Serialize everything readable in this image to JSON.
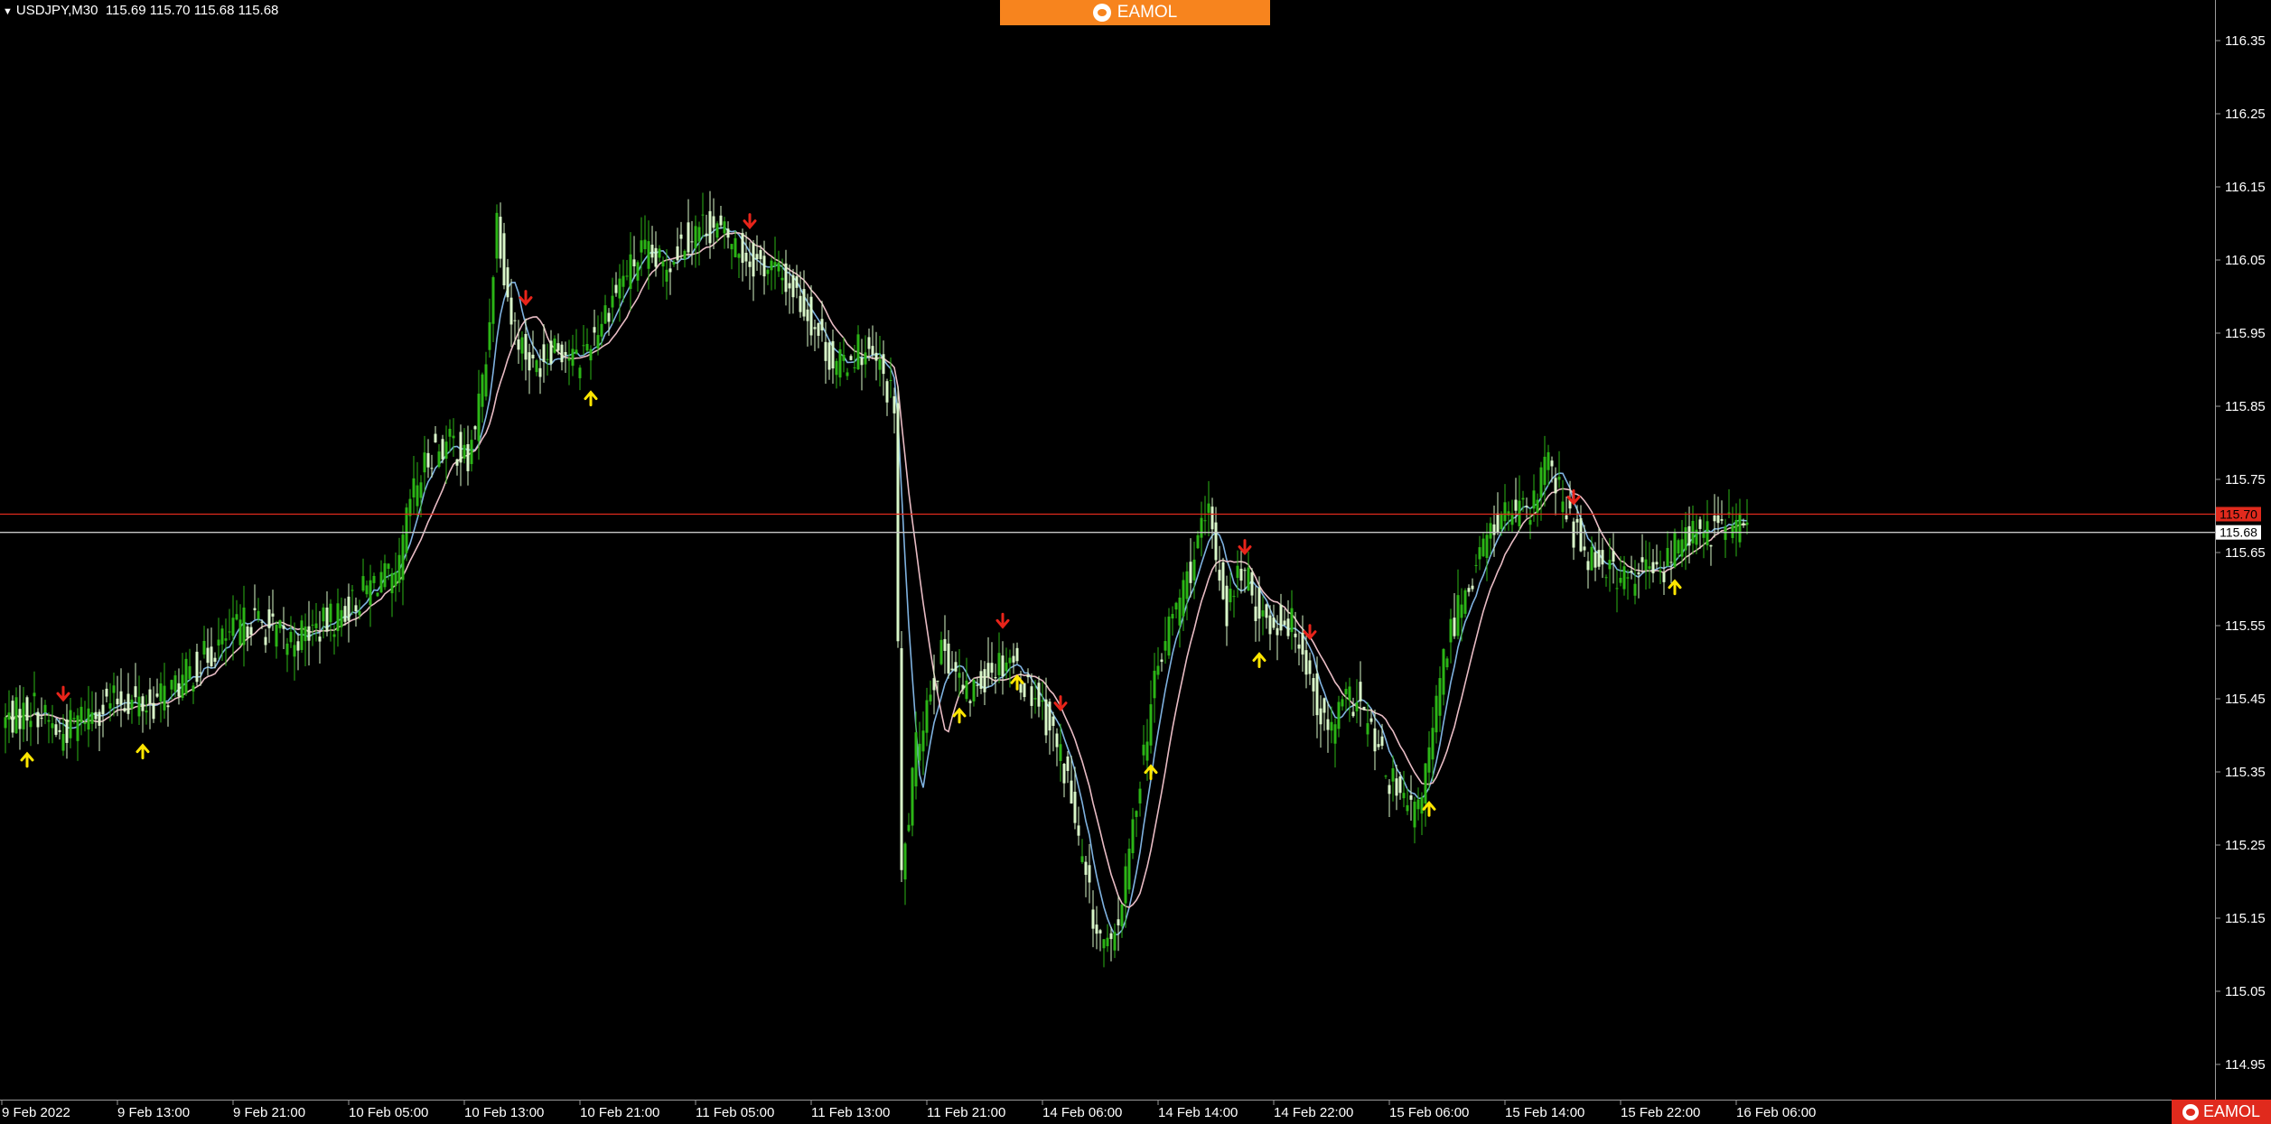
{
  "header": {
    "symbol_label": "USDJPY,M30",
    "ohlc_readout": "115.69 115.70 115.68 115.68"
  },
  "brand": {
    "banner_text": "EAMOL",
    "corner_text": "EAMOL",
    "banner_color": "#f7841e",
    "corner_color": "#e02a1d"
  },
  "chart_data": {
    "type": "candlestick",
    "symbol": "USDJPY",
    "timeframe": "M30",
    "ylim": [
      114.9,
      116.4
    ],
    "y_ticks": [
      "116.35",
      "116.25",
      "116.15",
      "116.05",
      "115.95",
      "115.85",
      "115.75",
      "115.65",
      "115.55",
      "115.45",
      "115.35",
      "115.25",
      "115.15",
      "115.05",
      "114.95"
    ],
    "x_ticks": [
      "9 Feb 2022",
      "9 Feb 13:00",
      "9 Feb 21:00",
      "10 Feb 05:00",
      "10 Feb 13:00",
      "10 Feb 21:00",
      "11 Feb 05:00",
      "11 Feb 13:00",
      "11 Feb 21:00",
      "14 Feb 06:00",
      "14 Feb 14:00",
      "14 Feb 22:00",
      "15 Feb 06:00",
      "15 Feb 14:00",
      "15 Feb 22:00",
      "16 Feb 06:00"
    ],
    "ask_line": {
      "value": 115.7,
      "label": "115.70",
      "color": "#e02a1d"
    },
    "bid_line": {
      "value": 115.68,
      "label": "115.68",
      "color": "#c8c8c8"
    },
    "anchors": [
      [
        0,
        115.42
      ],
      [
        8,
        115.44
      ],
      [
        15,
        115.4
      ],
      [
        22,
        115.43
      ],
      [
        32,
        115.45
      ],
      [
        40,
        115.44
      ],
      [
        48,
        115.47
      ],
      [
        58,
        115.52
      ],
      [
        68,
        115.56
      ],
      [
        78,
        115.53
      ],
      [
        88,
        115.55
      ],
      [
        96,
        115.58
      ],
      [
        104,
        115.62
      ],
      [
        108,
        115.6
      ],
      [
        112,
        115.72
      ],
      [
        118,
        115.79
      ],
      [
        124,
        115.8
      ],
      [
        128,
        115.77
      ],
      [
        133,
        115.91
      ],
      [
        136,
        116.11
      ],
      [
        140,
        115.97
      ],
      [
        146,
        115.9
      ],
      [
        152,
        115.94
      ],
      [
        158,
        115.91
      ],
      [
        164,
        115.96
      ],
      [
        170,
        116.02
      ],
      [
        176,
        116.06
      ],
      [
        182,
        116.04
      ],
      [
        188,
        116.08
      ],
      [
        194,
        116.1
      ],
      [
        200,
        116.08
      ],
      [
        206,
        116.05
      ],
      [
        212,
        116.04
      ],
      [
        218,
        116.01
      ],
      [
        224,
        115.96
      ],
      [
        230,
        115.9
      ],
      [
        236,
        115.93
      ],
      [
        242,
        115.9
      ],
      [
        246,
        115.85
      ],
      [
        248,
        115.2
      ],
      [
        252,
        115.38
      ],
      [
        256,
        115.47
      ],
      [
        260,
        115.52
      ],
      [
        266,
        115.45
      ],
      [
        272,
        115.49
      ],
      [
        278,
        115.51
      ],
      [
        282,
        115.47
      ],
      [
        286,
        115.45
      ],
      [
        290,
        115.4
      ],
      [
        294,
        115.34
      ],
      [
        298,
        115.22
      ],
      [
        302,
        115.13
      ],
      [
        306,
        115.1
      ],
      [
        310,
        115.2
      ],
      [
        314,
        115.35
      ],
      [
        318,
        115.47
      ],
      [
        322,
        115.55
      ],
      [
        326,
        115.6
      ],
      [
        330,
        115.66
      ],
      [
        333,
        115.7
      ],
      [
        338,
        115.57
      ],
      [
        342,
        115.63
      ],
      [
        346,
        115.58
      ],
      [
        350,
        115.55
      ],
      [
        354,
        115.56
      ],
      [
        358,
        115.54
      ],
      [
        362,
        115.46
      ],
      [
        366,
        115.4
      ],
      [
        370,
        115.44
      ],
      [
        374,
        115.45
      ],
      [
        378,
        115.4
      ],
      [
        382,
        115.35
      ],
      [
        386,
        115.31
      ],
      [
        390,
        115.29
      ],
      [
        394,
        115.37
      ],
      [
        398,
        115.5
      ],
      [
        402,
        115.58
      ],
      [
        406,
        115.62
      ],
      [
        410,
        115.67
      ],
      [
        414,
        115.7
      ],
      [
        418,
        115.71
      ],
      [
        422,
        115.69
      ],
      [
        426,
        115.78
      ],
      [
        430,
        115.73
      ],
      [
        434,
        115.68
      ],
      [
        438,
        115.65
      ],
      [
        442,
        115.64
      ],
      [
        446,
        115.62
      ],
      [
        450,
        115.61
      ],
      [
        454,
        115.63
      ],
      [
        458,
        115.62
      ],
      [
        462,
        115.66
      ],
      [
        466,
        115.68
      ],
      [
        470,
        115.67
      ],
      [
        474,
        115.69
      ],
      [
        478,
        115.69
      ],
      [
        482,
        115.68
      ]
    ],
    "sell_signal_bars": [
      16,
      144,
      206,
      276,
      292,
      343,
      361,
      434
    ],
    "buy_signal_bars": [
      6,
      38,
      162,
      264,
      280,
      317,
      347,
      394,
      462
    ],
    "ma_fast_color": "#7fb2e0",
    "ma_slow_color": "#e8bcc4",
    "bull_color": "#2bb516",
    "bear_color": "#d9f7c9",
    "grid": false
  }
}
